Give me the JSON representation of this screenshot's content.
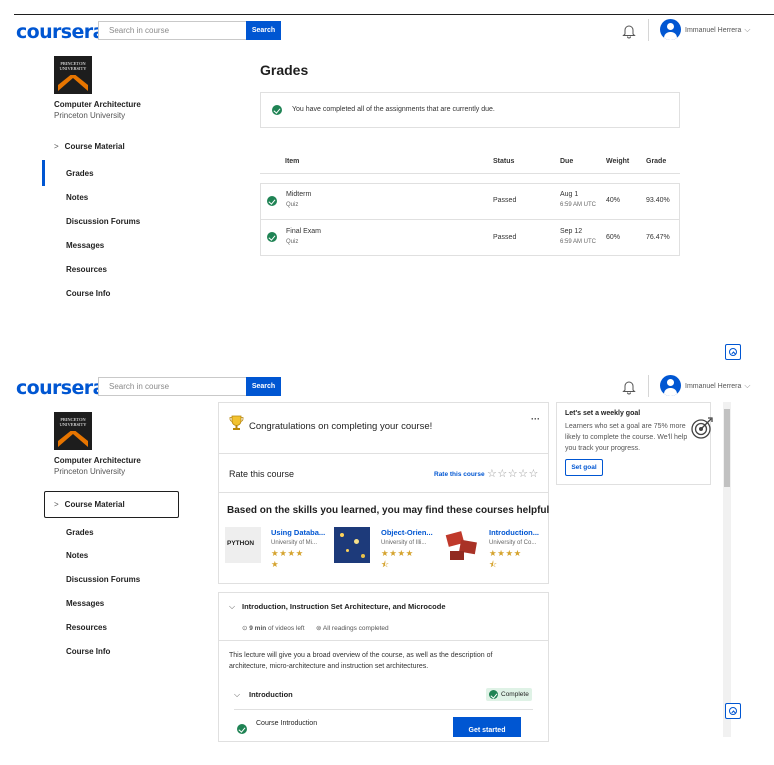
{
  "brand": {
    "logo": "coursera",
    "color": "#0056d2"
  },
  "search": {
    "placeholder": "Search in course",
    "button": "Search"
  },
  "user": {
    "name": "Immanuel Herrera"
  },
  "course": {
    "logo_lines": [
      "PRINCETON",
      "UNIVERSITY"
    ],
    "title": "Computer Architecture",
    "university": "Princeton University"
  },
  "sidebar": {
    "items": [
      {
        "label": "Course Material",
        "icon": "chevron-right-icon"
      },
      {
        "label": "Grades"
      },
      {
        "label": "Notes"
      },
      {
        "label": "Discussion Forums"
      },
      {
        "label": "Messages"
      },
      {
        "label": "Resources"
      },
      {
        "label": "Course Info"
      }
    ]
  },
  "grades": {
    "title": "Grades",
    "notice": "You have completed all of the assignments that are currently due.",
    "columns": [
      "Item",
      "Status",
      "Due",
      "Weight",
      "Grade"
    ],
    "rows": [
      {
        "item": "Midterm",
        "type": "Quiz",
        "status": "Passed",
        "due_date": "Aug 1",
        "due_time": "6:59 AM UTC",
        "weight": "40%",
        "grade": "93.40%"
      },
      {
        "item": "Final Exam",
        "type": "Quiz",
        "status": "Passed",
        "due_date": "Sep 12",
        "due_time": "6:59 AM UTC",
        "weight": "60%",
        "grade": "76.47%"
      }
    ]
  },
  "home": {
    "congrats": "Congratulations on completing your course!",
    "more": "···",
    "rate_label": "Rate this course",
    "rate_link": "Rate this course",
    "empty_stars": "☆☆☆☆☆",
    "rec_title": "Based on the skills you learned, you may find these courses helpful",
    "recommendations": [
      {
        "name": "Using Databa...",
        "university": "University of Mi...",
        "stars": "★★★★ ★",
        "thumb_text": "PYTHON"
      },
      {
        "name": "Object-Orien...",
        "university": "University of Illi...",
        "stars": "★★★★ ⯪"
      },
      {
        "name": "Introduction...",
        "university": "University of Co...",
        "stars": "★★★★ ⯪"
      }
    ],
    "module": {
      "title": "Introduction, Instruction Set Architecture, and Microcode",
      "videos_bold": "9 min",
      "videos_rest": " of videos left",
      "readings": "All readings completed",
      "description": "This lecture will give you a broad overview of the course, as well as the description of architecture, micro-architecture and instruction set architectures.",
      "lesson": "Introduction",
      "lesson_status": "Complete",
      "item": "Course Introduction",
      "cta": "Get started"
    },
    "goal": {
      "title": "Let's set a weekly goal",
      "text": "Learners who set a goal are 75% more likely to complete the course. We'll help you track your progress.",
      "button": "Set goal"
    }
  },
  "colors": {
    "accent": "#0056d2",
    "success": "#1f8354",
    "star": "#d5a32e"
  }
}
